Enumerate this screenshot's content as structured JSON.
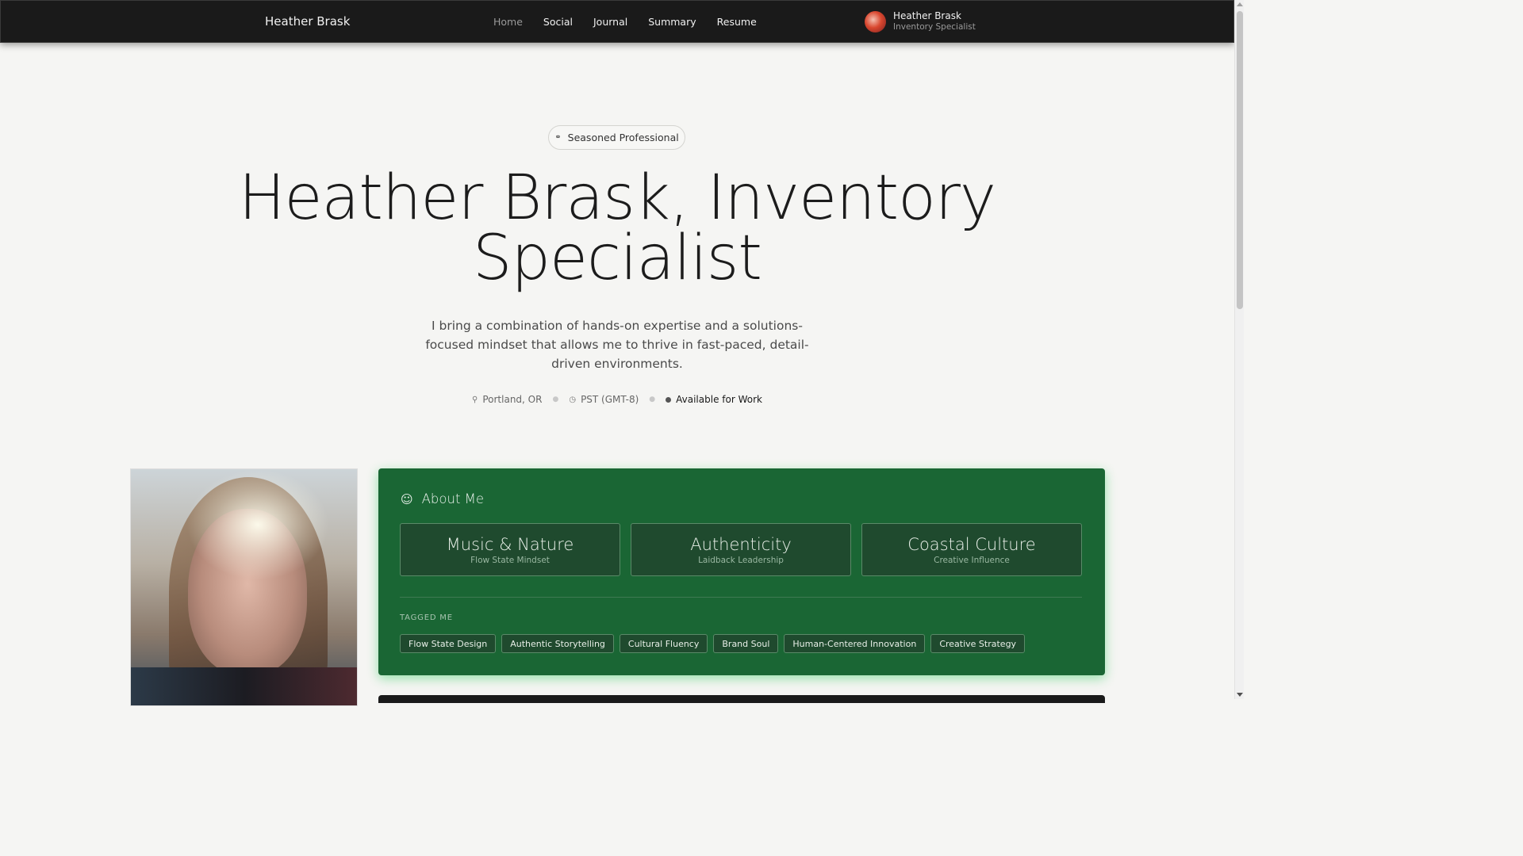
{
  "nav": {
    "brand": "Heather Brask",
    "links": [
      "Home",
      "Social",
      "Journal",
      "Summary",
      "Resume"
    ],
    "active": "Home",
    "profile_name": "Heather Brask",
    "profile_role": "Inventory Specialist"
  },
  "hero": {
    "badge": "Seasoned Professional",
    "title": "Heather Brask, Inventory Specialist",
    "subtitle": "I bring a combination of hands-on expertise and a solutions-focused mindset that allows me to thrive in fast-paced, detail-driven environments.",
    "location": "Portland, OR",
    "timezone": "PST (GMT-8)",
    "status": "Available for Work"
  },
  "about": {
    "heading": "About Me",
    "stats": [
      {
        "value": "Music & Nature",
        "label": "Flow State Mindset"
      },
      {
        "value": "Authenticity",
        "label": "Laidback Leadership"
      },
      {
        "value": "Coastal Culture",
        "label": "Creative Influence"
      }
    ],
    "tagged_label": "TAGGED ME",
    "tags": [
      "Flow State Design",
      "Authentic Storytelling",
      "Cultural Fluency",
      "Brand Soul",
      "Human-Centered Innovation",
      "Creative Strategy"
    ]
  },
  "colors": {
    "nav_bg": "#1a1a1a",
    "page_bg": "#f5f5f3",
    "about_bg": "#1a6634",
    "about_tile": "#1f4a2e"
  },
  "icons": {
    "badge": "award-icon",
    "about": "user-icon",
    "location": "map-pin-icon",
    "timezone": "clock-icon",
    "status": "status-dot-icon"
  }
}
